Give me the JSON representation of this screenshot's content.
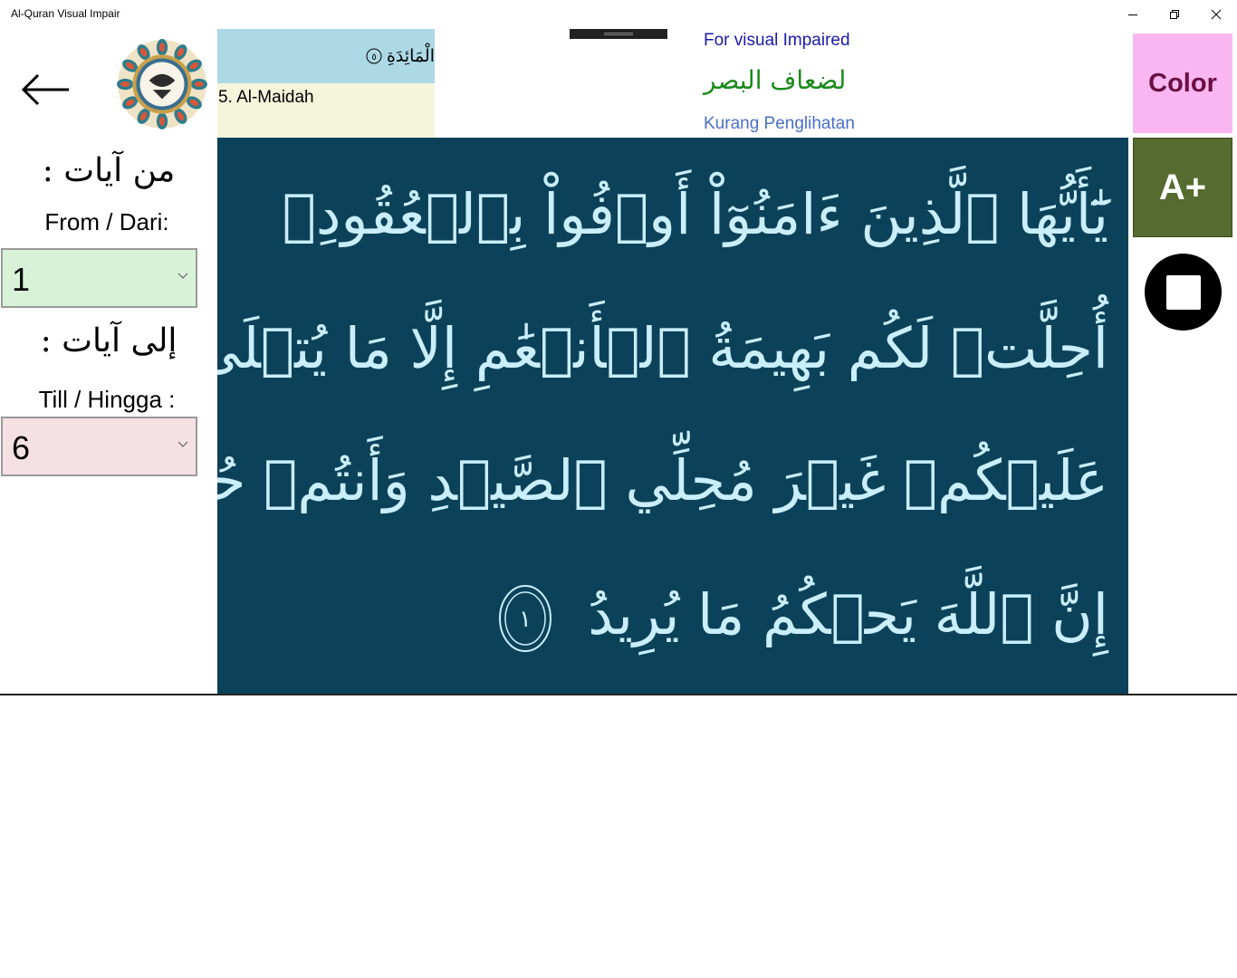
{
  "window": {
    "title": "Al-Quran Visual Impair"
  },
  "surah": {
    "arabic_name": "الْمَائِدَةِ",
    "number_glyph": "٥",
    "latin_name": "5. Al-Maidah"
  },
  "tagline": {
    "english": "For visual Impaired",
    "arabic": "لضعاف البصر",
    "indonesian": "Kurang Penglihatan"
  },
  "controls": {
    "color_label": "Color",
    "font_size_label": "A+"
  },
  "range": {
    "from_arabic": "من آيات :",
    "from_label": "From / Dari:",
    "from_value": "1",
    "to_arabic": "إلى آيات :",
    "to_label": "Till / Hingga :",
    "to_value": "6"
  },
  "verse": {
    "line1": "يَٰٓأَيُّهَا ٱلَّذِينَ ءَامَنُوٓاْ أَوۡفُواْ بِٱلۡعُقُودِۚ",
    "line2": "أُحِلَّتۡ لَكُم بَهِيمَةُ ٱلۡأَنۡعَٰمِ إِلَّا مَا يُتۡلَىٰ",
    "line3": "عَلَيۡكُمۡ غَيۡرَ مُحِلِّي ٱلصَّيۡدِ وَأَنتُمۡ حُرُمٌۗ",
    "line4": "إِنَّ ٱللَّهَ يَحۡكُمُ مَا يُرِيدُ",
    "ayah_number": "١"
  },
  "colors": {
    "verse_bg": "#0c4259",
    "verse_text": "#c9eefc",
    "color_button": "#f9b6f0",
    "font_button": "#556b2f",
    "from_select": "#d8f2d8",
    "to_select": "#f5e0e3"
  },
  "icons": {
    "back": "arrow-left-icon",
    "logo": "quran-medallion-logo",
    "stop": "stop-icon",
    "dropdown": "chevron-down-icon"
  }
}
